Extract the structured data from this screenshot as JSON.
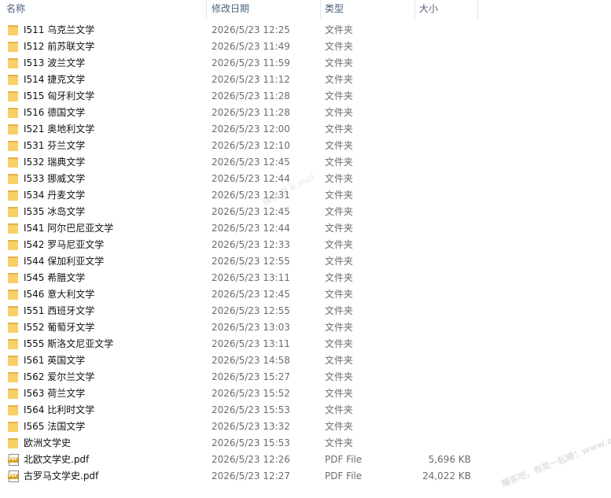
{
  "columns": {
    "name": "名称",
    "date": "修改日期",
    "type": "类型",
    "size": "大小"
  },
  "files": [
    {
      "name": "I511 乌克兰文学",
      "date": "2026/5/23 12:25",
      "type": "文件夹",
      "size": "",
      "icon": "folder-icon"
    },
    {
      "name": "I512 前苏联文学",
      "date": "2026/5/23 11:49",
      "type": "文件夹",
      "size": "",
      "icon": "folder-icon"
    },
    {
      "name": "I513 波兰文学",
      "date": "2026/5/23 11:59",
      "type": "文件夹",
      "size": "",
      "icon": "folder-icon"
    },
    {
      "name": "I514 捷克文学",
      "date": "2026/5/23 11:12",
      "type": "文件夹",
      "size": "",
      "icon": "folder-icon"
    },
    {
      "name": "I515 匈牙利文学",
      "date": "2026/5/23 11:28",
      "type": "文件夹",
      "size": "",
      "icon": "folder-icon"
    },
    {
      "name": "I516 德国文学",
      "date": "2026/5/23 11:28",
      "type": "文件夹",
      "size": "",
      "icon": "folder-icon"
    },
    {
      "name": "I521 奥地利文学",
      "date": "2026/5/23 12:00",
      "type": "文件夹",
      "size": "",
      "icon": "folder-icon"
    },
    {
      "name": "I531 芬兰文学",
      "date": "2026/5/23 12:10",
      "type": "文件夹",
      "size": "",
      "icon": "folder-icon"
    },
    {
      "name": "I532 瑞典文学",
      "date": "2026/5/23 12:45",
      "type": "文件夹",
      "size": "",
      "icon": "folder-icon"
    },
    {
      "name": "I533 挪威文学",
      "date": "2026/5/23 12:44",
      "type": "文件夹",
      "size": "",
      "icon": "folder-icon"
    },
    {
      "name": "I534 丹麦文学",
      "date": "2026/5/23 12:31",
      "type": "文件夹",
      "size": "",
      "icon": "folder-icon"
    },
    {
      "name": "I535 冰岛文学",
      "date": "2026/5/23 12:45",
      "type": "文件夹",
      "size": "",
      "icon": "folder-icon"
    },
    {
      "name": "I541 阿尔巴尼亚文学",
      "date": "2026/5/23 12:44",
      "type": "文件夹",
      "size": "",
      "icon": "folder-icon"
    },
    {
      "name": "I542 罗马尼亚文学",
      "date": "2026/5/23 12:33",
      "type": "文件夹",
      "size": "",
      "icon": "folder-icon"
    },
    {
      "name": "I544 保加利亚文学",
      "date": "2026/5/23 12:55",
      "type": "文件夹",
      "size": "",
      "icon": "folder-icon"
    },
    {
      "name": "I545 希腊文学",
      "date": "2026/5/23 13:11",
      "type": "文件夹",
      "size": "",
      "icon": "folder-icon"
    },
    {
      "name": "I546 意大利文学",
      "date": "2026/5/23 12:45",
      "type": "文件夹",
      "size": "",
      "icon": "folder-icon"
    },
    {
      "name": "I551 西班牙文学",
      "date": "2026/5/23 12:55",
      "type": "文件夹",
      "size": "",
      "icon": "folder-icon"
    },
    {
      "name": "I552 葡萄牙文学",
      "date": "2026/5/23 13:03",
      "type": "文件夹",
      "size": "",
      "icon": "folder-icon"
    },
    {
      "name": "I555 斯洛文尼亚文学",
      "date": "2026/5/23 13:11",
      "type": "文件夹",
      "size": "",
      "icon": "folder-icon"
    },
    {
      "name": "I561 英国文学",
      "date": "2026/5/23 14:58",
      "type": "文件夹",
      "size": "",
      "icon": "folder-icon"
    },
    {
      "name": "I562 爱尔兰文学",
      "date": "2026/5/23 15:27",
      "type": "文件夹",
      "size": "",
      "icon": "folder-icon"
    },
    {
      "name": "I563 荷兰文学",
      "date": "2026/5/23 15:52",
      "type": "文件夹",
      "size": "",
      "icon": "folder-icon"
    },
    {
      "name": "I564 比利时文学",
      "date": "2026/5/23 15:53",
      "type": "文件夹",
      "size": "",
      "icon": "folder-icon"
    },
    {
      "name": "I565 法国文学",
      "date": "2026/5/23 13:32",
      "type": "文件夹",
      "size": "",
      "icon": "folder-icon"
    },
    {
      "name": "欧洲文学史",
      "date": "2026/5/23 15:53",
      "type": "文件夹",
      "size": "",
      "icon": "folder-icon"
    },
    {
      "name": "北欧文学史.pdf",
      "date": "2026/5/23 12:26",
      "type": "PDF File",
      "size": "5,696 KB",
      "icon": "pdf-file-icon"
    },
    {
      "name": "古罗马文学史.pdf",
      "date": "2026/5/23 12:27",
      "type": "PDF File",
      "size": "24,022 KB",
      "icon": "pdf-file-icon"
    }
  ],
  "watermarks": {
    "center": "赚客吧 k.mei",
    "corner": "赚客吧，有奖一起赚！www.zuanke8.com"
  },
  "colors": {
    "folder": "#f8d067",
    "folder_back": "#e3b14a",
    "pdf_badge": "#d8a320",
    "header_text": "#4c607a",
    "secondary_text": "#6d6d6d"
  }
}
